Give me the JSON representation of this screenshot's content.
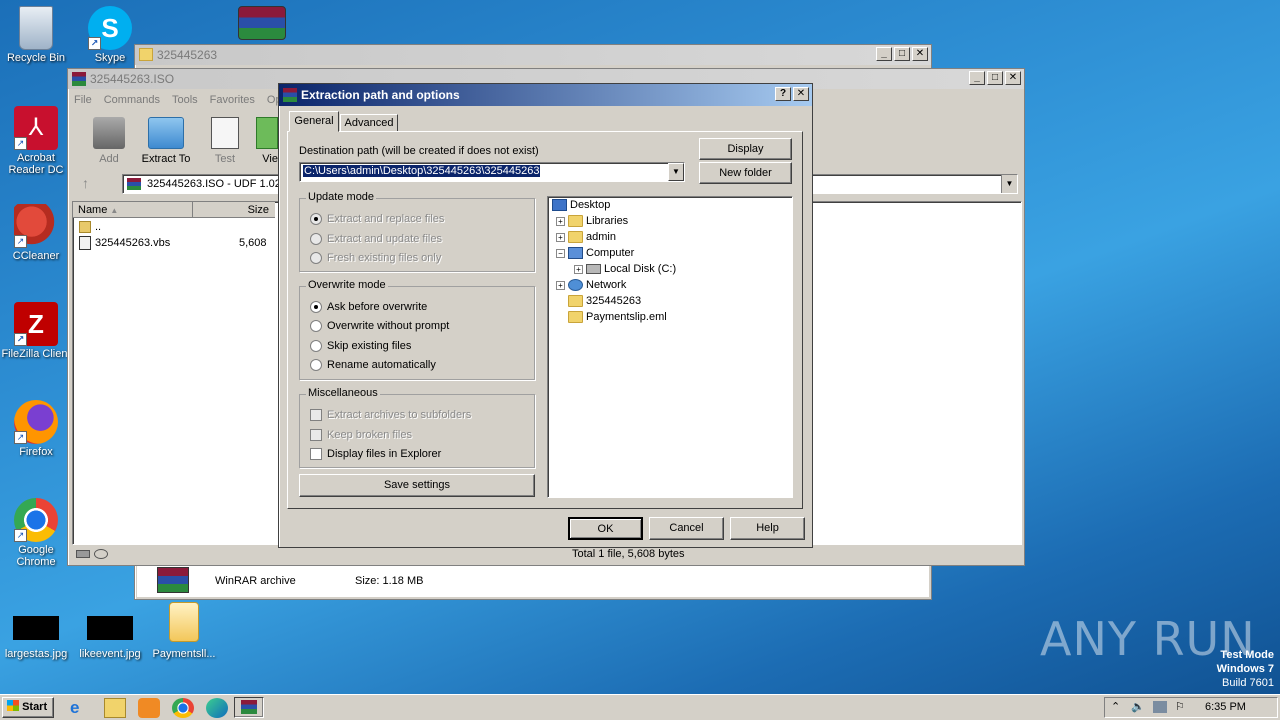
{
  "desktop": {
    "icons": [
      "Recycle Bin",
      "Skype",
      "Acrobat Reader DC",
      "CCleaner",
      "FileZilla Client",
      "Firefox",
      "Google Chrome",
      "largestas.jpg",
      "likeevent.jpg",
      "Paymentsll..."
    ]
  },
  "explorer_window": {
    "title": "325445263",
    "file_type": "WinRAR archive",
    "size": "Size: 1.18 MB"
  },
  "winrar_window": {
    "title": "325445263.ISO",
    "menu": [
      "File",
      "Commands",
      "Tools",
      "Favorites",
      "Opt"
    ],
    "toolbar": [
      "Add",
      "Extract To",
      "Test",
      "Vie"
    ],
    "path": "325445263.ISO - UDF 1.02",
    "columns": [
      "Name",
      "Size"
    ],
    "rows": [
      {
        "name": "..",
        "size": ""
      },
      {
        "name": "325445263.vbs",
        "size": "5,608"
      }
    ],
    "status": "Total 1 file, 5,608 bytes"
  },
  "dialog": {
    "title": "Extraction path and options",
    "tabs": [
      "General",
      "Advanced"
    ],
    "dest_label": "Destination path (will be created if does not exist)",
    "dest_value": "C:\\Users\\admin\\Desktop\\325445263\\325445263",
    "display_btn": "Display",
    "new_folder_btn": "New folder",
    "update_mode": {
      "legend": "Update mode",
      "options": [
        "Extract and replace files",
        "Extract and update files",
        "Fresh existing files only"
      ]
    },
    "overwrite_mode": {
      "legend": "Overwrite mode",
      "options": [
        "Ask before overwrite",
        "Overwrite without prompt",
        "Skip existing files",
        "Rename automatically"
      ]
    },
    "misc": {
      "legend": "Miscellaneous",
      "options": [
        "Extract archives to subfolders",
        "Keep broken files",
        "Display files in Explorer"
      ]
    },
    "save_settings": "Save settings",
    "tree": [
      "Desktop",
      "Libraries",
      "admin",
      "Computer",
      "Local Disk (C:)",
      "Network",
      "325445263",
      "Paymentslip.eml"
    ],
    "ok": "OK",
    "cancel": "Cancel",
    "help": "Help"
  },
  "taskbar": {
    "start": "Start",
    "time": "6:35 PM"
  },
  "watermark": {
    "brand": "ANY RUN",
    "line1": "Test Mode",
    "line2": "Windows 7",
    "line3": "Build 7601"
  }
}
